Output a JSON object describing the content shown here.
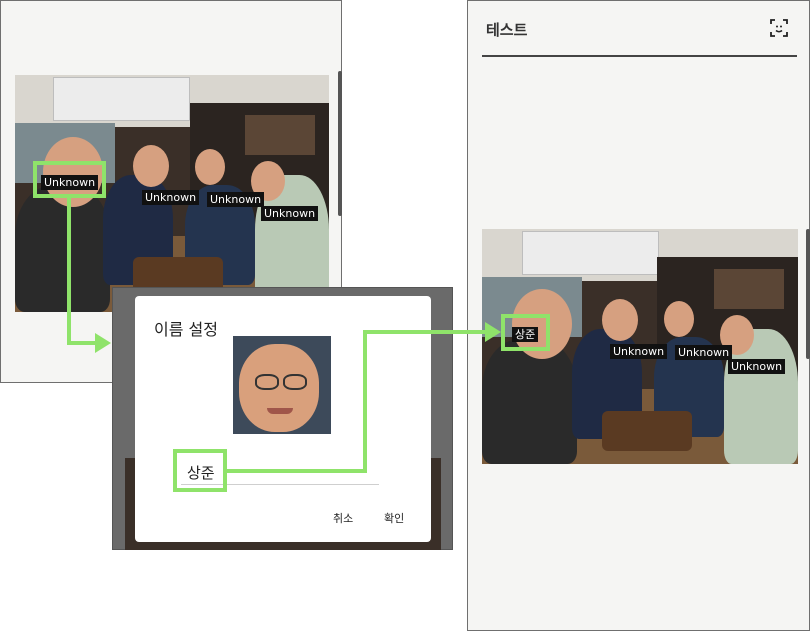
{
  "left_phone": {
    "face_tags": [
      "Unknown",
      "Unknown",
      "Unknown",
      "Unknown"
    ]
  },
  "dialog": {
    "title": "이름 설정",
    "name_value": "상준",
    "cancel_label": "취소",
    "confirm_label": "확인"
  },
  "right_phone": {
    "title": "테스트",
    "face_scan_icon": "face-scan-icon",
    "face_tags": [
      "상준",
      "Unknown",
      "Unknown",
      "Unknown"
    ]
  },
  "colors": {
    "highlight": "#8fe36a",
    "tag_bg": "#111111",
    "screen_bg": "#f5f5f3"
  }
}
